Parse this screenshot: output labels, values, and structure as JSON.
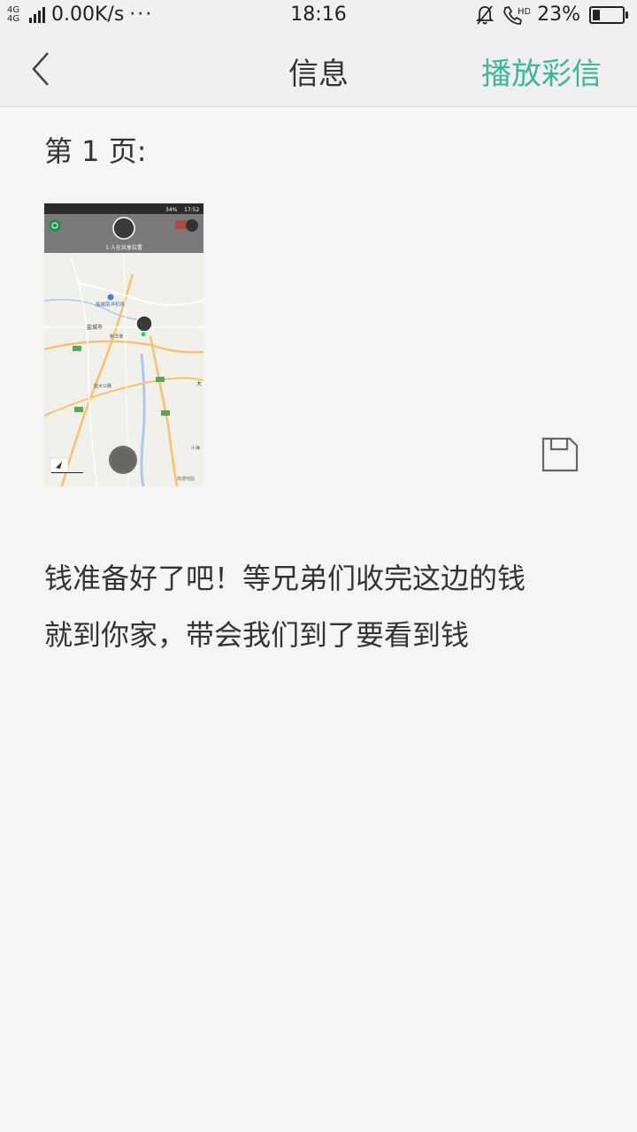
{
  "status_bar": {
    "network": "4G 4G",
    "speed": "0.00K/s",
    "more": "···",
    "time": "18:16",
    "battery_percent": "23%",
    "battery_level": 0.23
  },
  "header": {
    "title": "信息",
    "action_label": "播放彩信"
  },
  "mms": {
    "page_label": "第 1 页:",
    "image": {
      "status_time": "17:52",
      "status_battery": "34%",
      "sharing_text": "1 人在共享位置",
      "map_labels": {
        "city": "盐城市",
        "airport": "盐城南洋机场",
        "road_1": "盐大公路",
        "road_2": "新洋港",
        "town_1": "大",
        "town_2": "小海",
        "attribution": "高德地图"
      }
    },
    "message_line_1": "钱准备好了吧！等兄弟们收完这边的钱",
    "message_line_2": "就到你家，带会我们到了要看到钱"
  },
  "colors": {
    "accent": "#3fb59b",
    "background": "#f5f5f5",
    "bar_background": "#f0f0f0"
  },
  "icons": [
    "back-chevron-icon",
    "mute-bell-icon",
    "hd-call-icon",
    "battery-icon",
    "save-icon"
  ]
}
